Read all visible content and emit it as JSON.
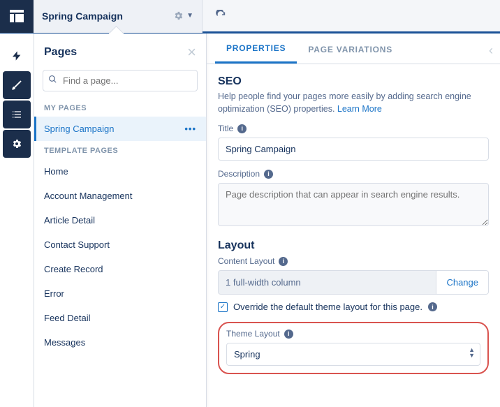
{
  "topbar": {
    "title": "Spring Campaign"
  },
  "sidebar": {
    "heading": "Pages",
    "search_placeholder": "Find a page...",
    "section_my": "MY PAGES",
    "section_template": "TEMPLATE PAGES",
    "selected": "Spring Campaign",
    "templates": [
      "Home",
      "Account Management",
      "Article Detail",
      "Contact Support",
      "Create Record",
      "Error",
      "Feed Detail",
      "Messages"
    ]
  },
  "tabs": {
    "properties": "PROPERTIES",
    "variations": "PAGE VARIATIONS"
  },
  "seo": {
    "heading": "SEO",
    "help": "Help people find your pages more easily by adding search engine optimization (SEO) properties. ",
    "learn": "Learn More",
    "title_label": "Title",
    "title_value": "Spring Campaign",
    "desc_label": "Description",
    "desc_placeholder": "Page description that can appear in search engine results."
  },
  "layout": {
    "heading": "Layout",
    "content_label": "Content Layout",
    "content_value": "1 full-width column",
    "change": "Change",
    "override": "Override the default theme layout for this page.",
    "theme_label": "Theme Layout",
    "theme_value": "Spring"
  }
}
